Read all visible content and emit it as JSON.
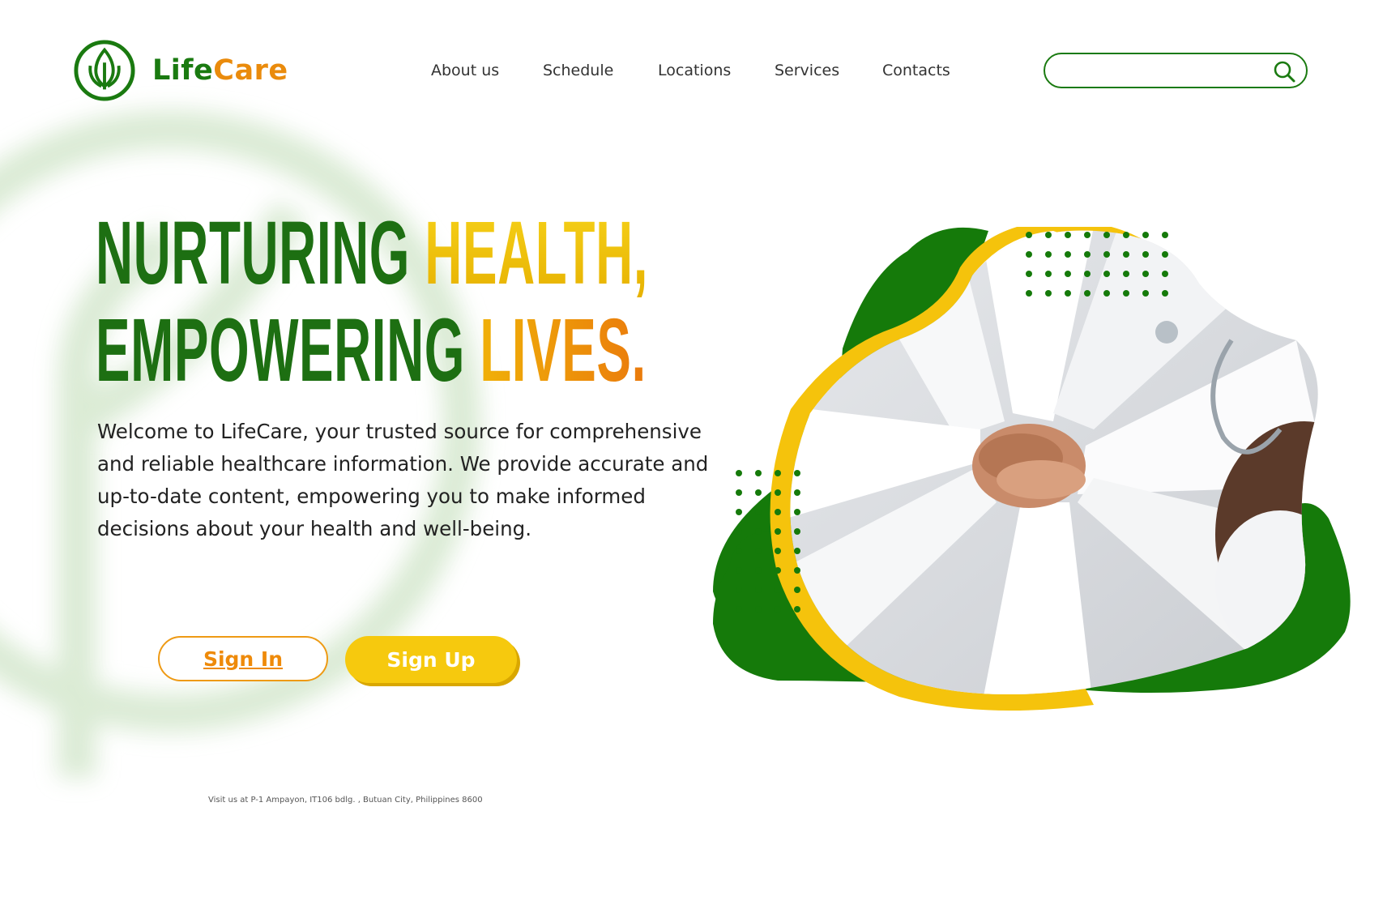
{
  "brand": {
    "name_part1": "Life",
    "name_part2": "Care",
    "color_primary": "#1a7a10",
    "color_accent": "#ea8b0c",
    "color_yellow": "#f6c90e"
  },
  "nav": {
    "items": [
      {
        "label": "About us"
      },
      {
        "label": "Schedule"
      },
      {
        "label": "Locations"
      },
      {
        "label": "Services"
      },
      {
        "label": "Contacts"
      }
    ]
  },
  "search": {
    "value": "",
    "placeholder": "",
    "icon": "search-icon"
  },
  "hero": {
    "line1_word1": "NURTURING",
    "line1_word2": "HEALTH,",
    "line2_word1": "EMPOWERING",
    "line2_word2": "LIVES.",
    "intro": "Welcome to LifeCare, your trusted source for comprehensive and reliable healthcare information. We provide accurate and up-to-date content, empowering you to make informed decisions about your health and well-being.",
    "signin_label": "Sign In",
    "signup_label": "Sign Up",
    "image": "doctors-hands-together-photo"
  },
  "footer": {
    "address": "Visit us at P-1 Ampayon, IT106 bdlg. , Butuan City, Philippines 8600"
  }
}
